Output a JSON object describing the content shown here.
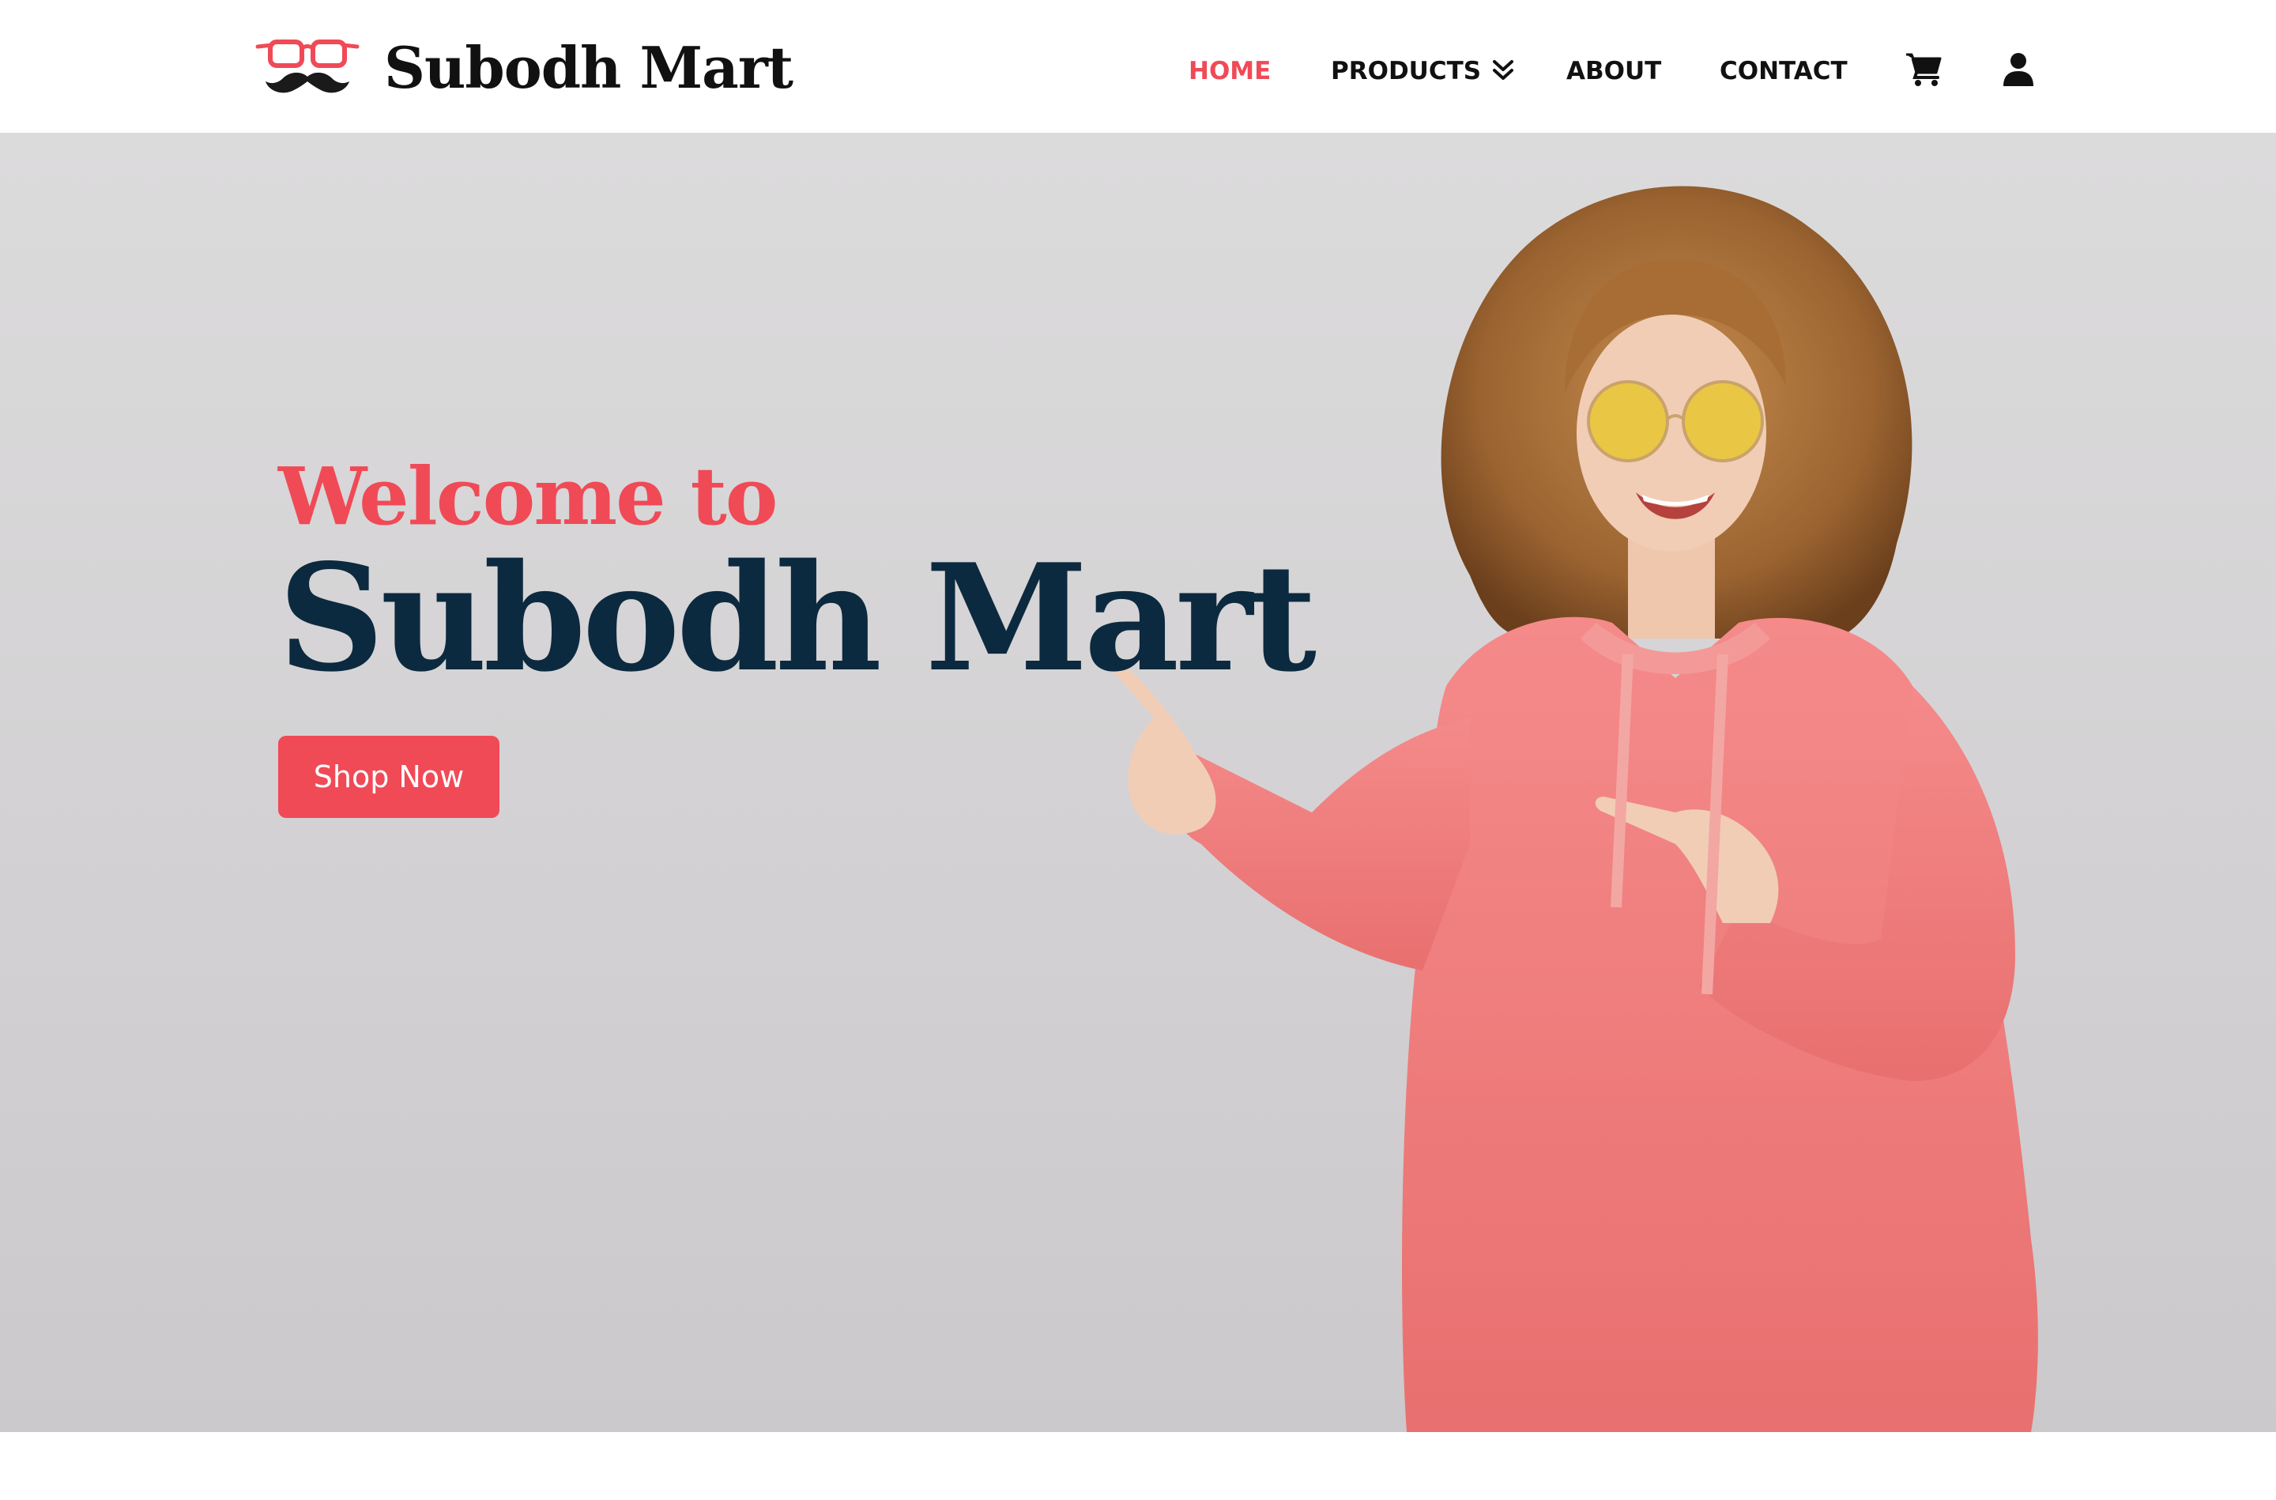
{
  "brand": {
    "name": "Subodh Mart",
    "logo_icon": "glasses-mustache-icon",
    "accent_color": "#f04a57",
    "dark_color": "#0c2a3f"
  },
  "nav": {
    "items": [
      {
        "label": "HOME",
        "active": true
      },
      {
        "label": "PRODUCTS",
        "has_dropdown": true
      },
      {
        "label": "ABOUT"
      },
      {
        "label": "CONTACT"
      }
    ],
    "icons": [
      "cart-icon",
      "user-icon"
    ]
  },
  "hero": {
    "welcome": "Welcome to",
    "title": "Subodh Mart",
    "cta_label": "Shop Now",
    "image_icon": "woman-pointing-photo"
  }
}
